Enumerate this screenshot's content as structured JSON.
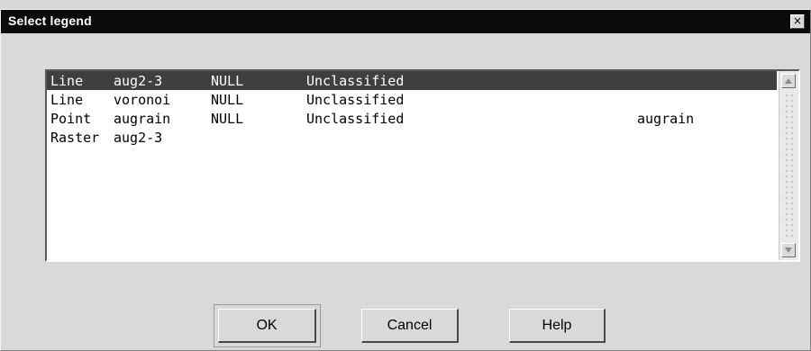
{
  "window": {
    "title": "Select legend",
    "close_glyph": "×"
  },
  "legend_list": {
    "rows": [
      {
        "type": "Line",
        "name": "aug2-3",
        "null": "NULL",
        "class": "Unclassified",
        "label": "",
        "selected": true
      },
      {
        "type": "Line",
        "name": "voronoi",
        "null": "NULL",
        "class": "Unclassified",
        "label": "",
        "selected": false
      },
      {
        "type": "Point",
        "name": "augrain",
        "null": "NULL",
        "class": "Unclassified",
        "label": "augrain",
        "selected": false
      },
      {
        "type": "Raster",
        "name": "aug2-3",
        "null": "",
        "class": "",
        "label": "",
        "selected": false
      }
    ]
  },
  "buttons": {
    "ok": "OK",
    "cancel": "Cancel",
    "help": "Help"
  },
  "colors": {
    "titlebar": "#0b0b0b",
    "selection": "#3f3f3f",
    "dialog_face": "#d9d9d9"
  },
  "icons": {
    "close": "close-icon",
    "scroll_up": "chevron-up-icon",
    "scroll_down": "chevron-down-icon"
  }
}
